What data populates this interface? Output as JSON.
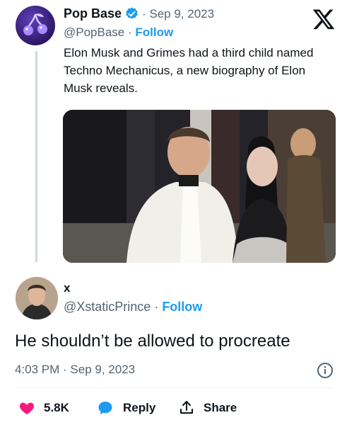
{
  "quoted_tweet": {
    "author_name": "Pop Base",
    "date_text": "· Sep 9, 2023",
    "handle": "@PopBase",
    "separator": " · ",
    "follow_label": "Follow",
    "text": "Elon Musk and Grimes had a third child named Techno Mechanicus, a new biography of Elon Musk reveals."
  },
  "main_tweet": {
    "author_name": "x",
    "handle": "@XstaticPrince",
    "separator": " · ",
    "follow_label": "Follow",
    "text": "He shouldn’t be allowed to procreate",
    "timestamp": "4:03 PM · Sep 9, 2023"
  },
  "actions": {
    "like_count": "5.8K",
    "reply_label": "Reply",
    "share_label": "Share"
  },
  "icons": {
    "brand": "x-logo-icon",
    "verified": "verified-badge-icon",
    "info": "info-icon",
    "like": "heart-icon",
    "reply": "reply-bubble-icon",
    "share": "share-icon"
  },
  "colors": {
    "accent": "#1d9bf0",
    "like": "#f91880",
    "muted_text": "#536471",
    "thread_line": "#cfd9de"
  }
}
